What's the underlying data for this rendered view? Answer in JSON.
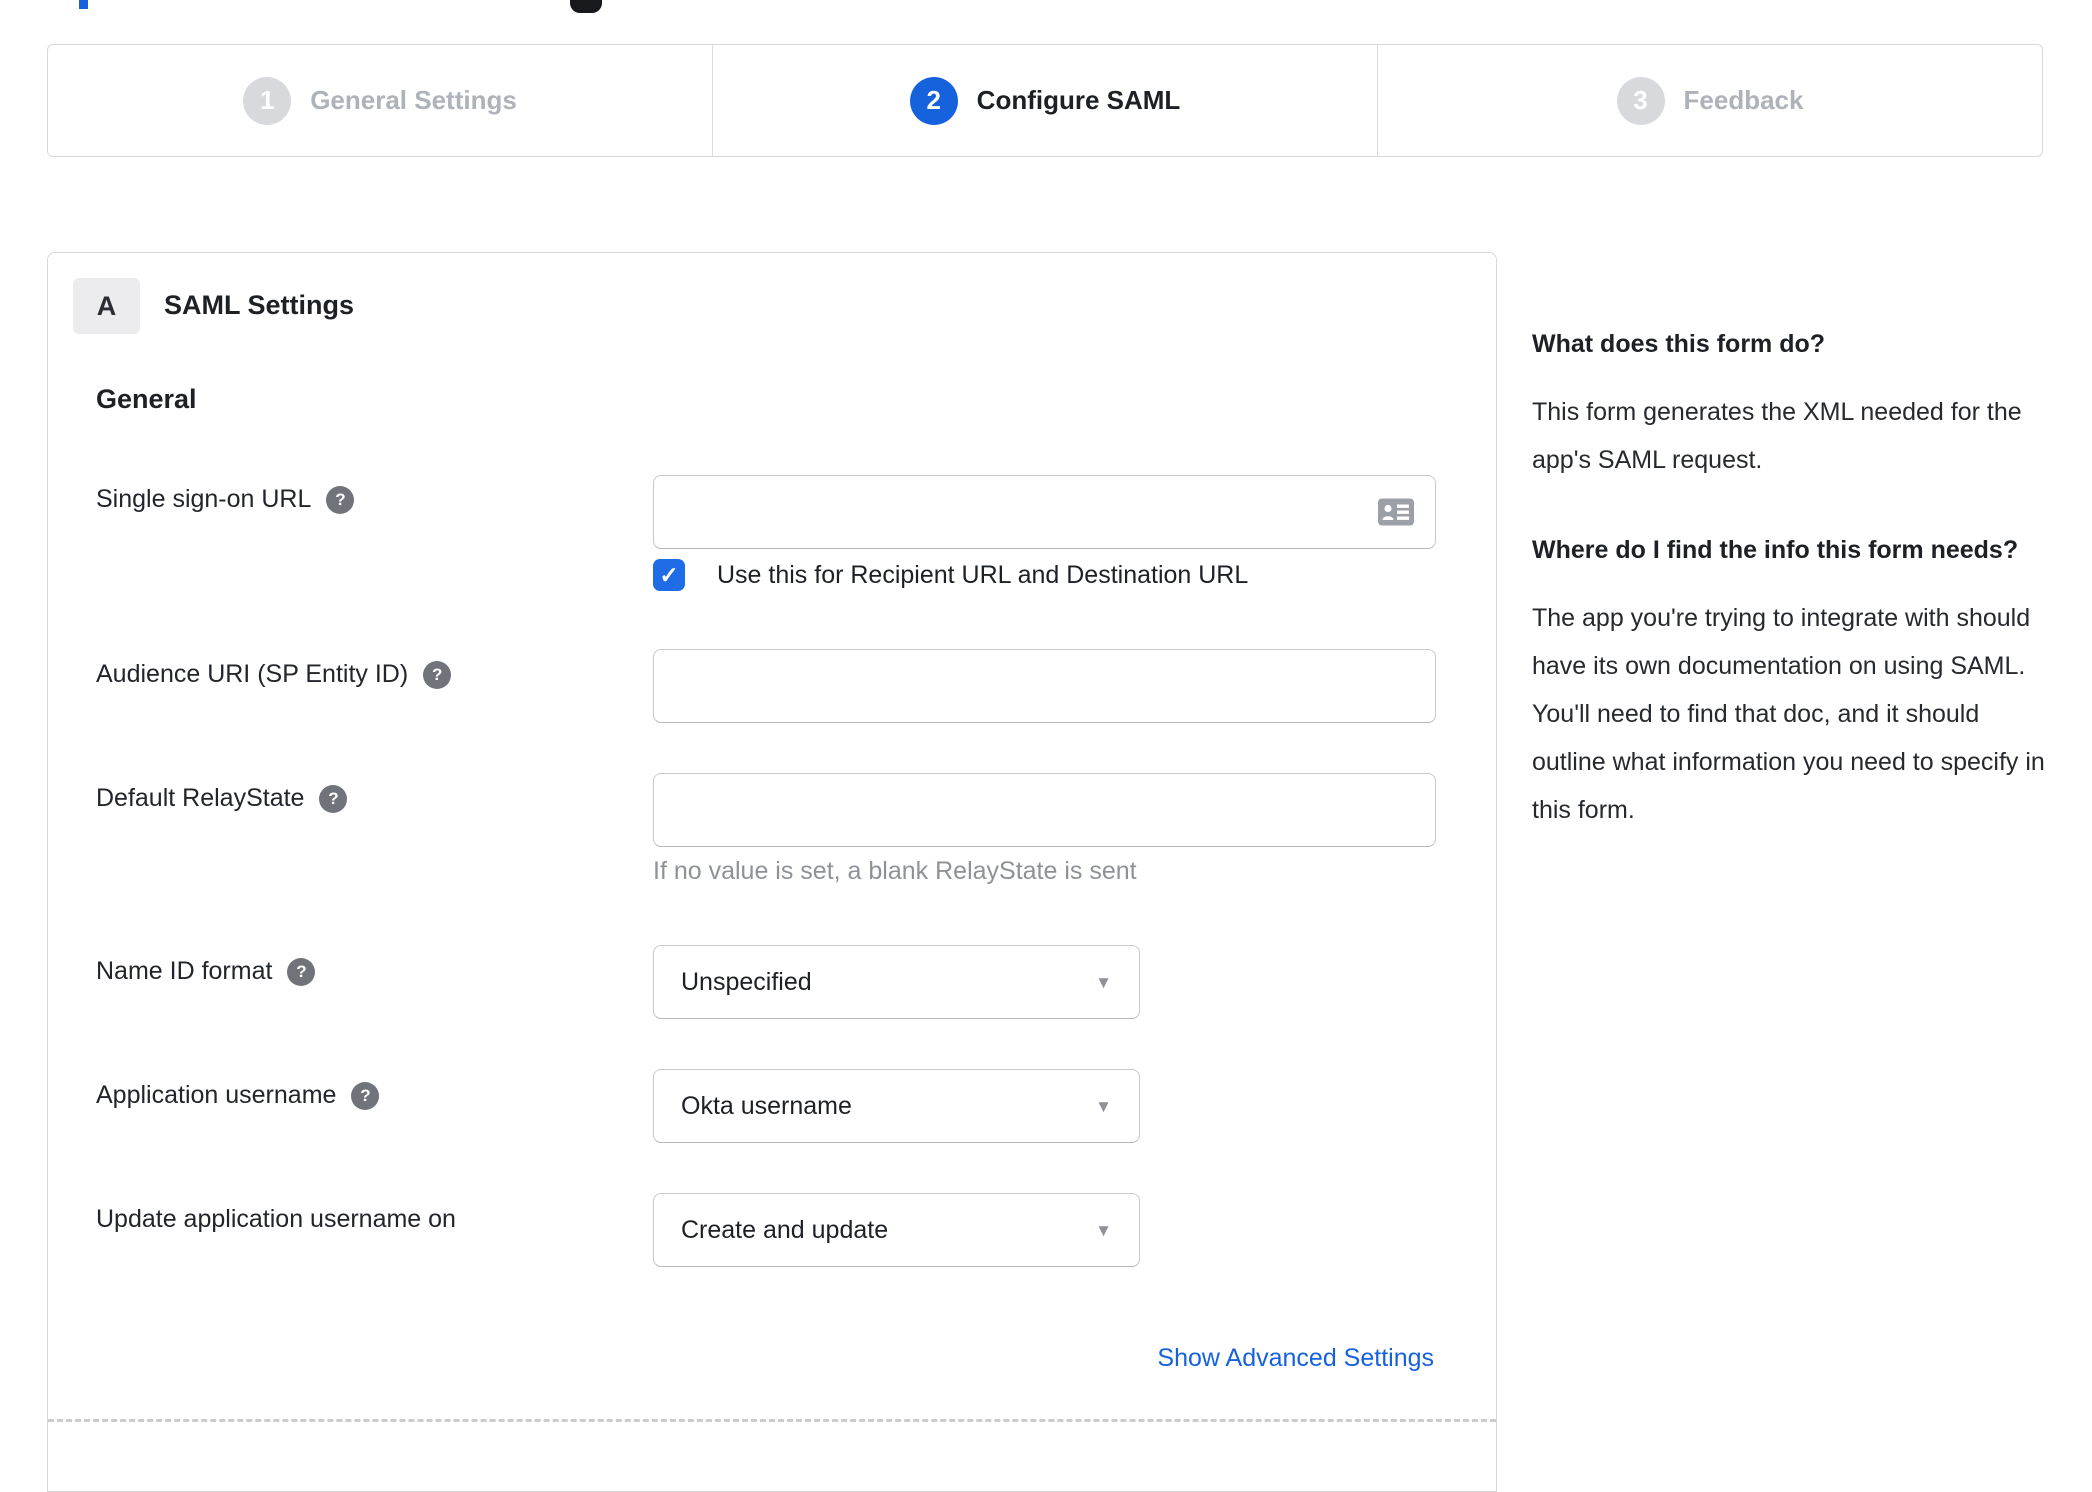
{
  "colors": {
    "accent_blue": "#1662dd",
    "checkbox_blue": "#1e6ce6",
    "inactive_step_gray": "#aeb2b9",
    "step_circle_gray": "#d7d9dc",
    "link_blue": "#1662dd"
  },
  "stepper": {
    "steps": [
      {
        "number": "1",
        "label": "General Settings",
        "state": "inactive"
      },
      {
        "number": "2",
        "label": "Configure SAML",
        "state": "active"
      },
      {
        "number": "3",
        "label": "Feedback",
        "state": "inactive"
      }
    ]
  },
  "panel": {
    "badge": "A",
    "title": "SAML Settings",
    "group_heading": "General",
    "fields": {
      "sso": {
        "label": "Single sign-on URL",
        "value": "",
        "checkbox_label": "Use this for Recipient URL and Destination URL",
        "checkbox_checked": true
      },
      "audience": {
        "label": "Audience URI (SP Entity ID)",
        "value": ""
      },
      "relay": {
        "label": "Default RelayState",
        "value": "",
        "hint": "If no value is set, a blank RelayState is sent"
      },
      "name_id": {
        "label": "Name ID format",
        "value": "Unspecified"
      },
      "app_username": {
        "label": "Application username",
        "value": "Okta username"
      },
      "update_username": {
        "label": "Update application username on",
        "value": "Create and update"
      }
    },
    "advanced_link": "Show Advanced Settings"
  },
  "sidebar": {
    "heading_1": "What does this form do?",
    "paragraph_1": "This form generates the XML needed for the app's SAML request.",
    "heading_2": "Where do I find the info this form needs?",
    "paragraph_2": "The app you're trying to integrate with should have its own documentation on using SAML. You'll need to find that doc, and it should outline what information you need to specify in this form."
  }
}
